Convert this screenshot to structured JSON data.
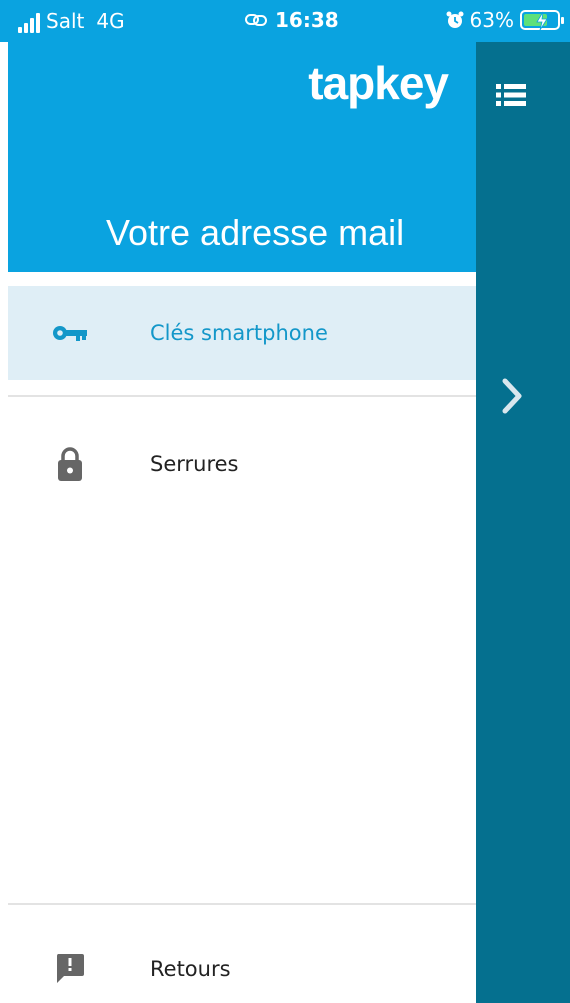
{
  "status_bar": {
    "carrier": "Salt",
    "network": "4G",
    "time": "16:38",
    "battery": "63%",
    "battery_level": 0.63,
    "icons": [
      "signal-icon",
      "link-icon",
      "alarm-icon",
      "battery-charging-icon"
    ]
  },
  "drawer": {
    "logo": "tapkey",
    "account_label": "Votre adresse mail",
    "items": [
      {
        "label": "Clés smartphone",
        "icon": "key-icon",
        "selected": true
      },
      {
        "label": "Serrures",
        "icon": "lock-icon",
        "selected": false
      }
    ],
    "footer_item": {
      "label": "Retours",
      "icon": "feedback-icon"
    }
  },
  "right_panel": {
    "icons": [
      "list-icon",
      "chevron-right-icon"
    ]
  },
  "colors": {
    "header_blue": "#0aa3e0",
    "panel_teal": "#05708f",
    "selected_bg": "#dfeef6",
    "selected_text": "#1397c9",
    "icon_gray": "#666666"
  }
}
